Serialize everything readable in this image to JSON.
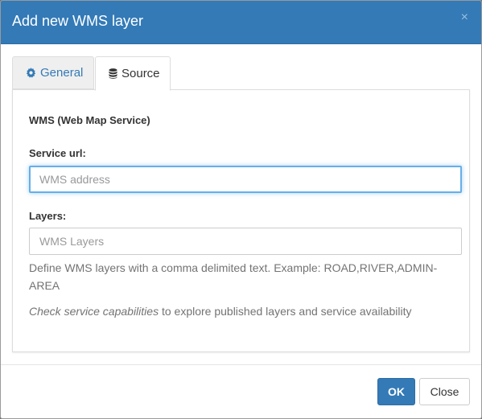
{
  "dialog": {
    "title": "Add new WMS layer",
    "close_glyph": "×"
  },
  "tabs": [
    {
      "label": "General",
      "icon": "gear-icon",
      "active": false
    },
    {
      "label": "Source",
      "icon": "database-icon",
      "active": true
    }
  ],
  "source": {
    "section_title": "WMS (Web Map Service)",
    "service_url": {
      "label": "Service url:",
      "value": "",
      "placeholder": "WMS address"
    },
    "layers": {
      "label": "Layers:",
      "value": "",
      "placeholder": "WMS Layers",
      "help": "Define WMS layers with a comma delimited text. Example: ROAD,RIVER,ADMIN-AREA"
    },
    "capabilities": {
      "link_text": "Check service capabilities",
      "suffix": " to explore published layers and service availability"
    }
  },
  "footer": {
    "ok_label": "OK",
    "close_label": "Close"
  },
  "colors": {
    "header": "#337ab7",
    "primary": "#337ab7",
    "focus": "#66afe9"
  }
}
